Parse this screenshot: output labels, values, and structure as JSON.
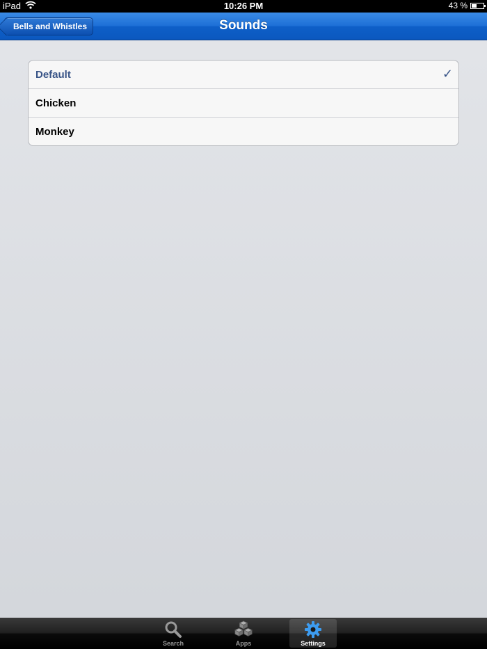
{
  "status_bar": {
    "device": "iPad",
    "time": "10:26 PM",
    "battery_text": "43 %",
    "battery_level": 0.43
  },
  "nav_bar": {
    "back_label": "Bells and Whistles",
    "title": "Sounds"
  },
  "sounds_list": {
    "items": [
      {
        "label": "Default",
        "selected": true
      },
      {
        "label": "Chicken",
        "selected": false
      },
      {
        "label": "Monkey",
        "selected": false
      }
    ],
    "checkmark": "✓"
  },
  "tab_bar": {
    "tabs": [
      {
        "label": "Search",
        "icon": "search-icon",
        "active": false
      },
      {
        "label": "Apps",
        "icon": "apps-icon",
        "active": false
      },
      {
        "label": "Settings",
        "icon": "gear-icon",
        "active": true
      }
    ]
  },
  "colors": {
    "nav_blue": "#1d6fd6",
    "selected_text": "#385487",
    "background": "#dcdee2",
    "active_tab_icon": "#3d9cf0"
  }
}
